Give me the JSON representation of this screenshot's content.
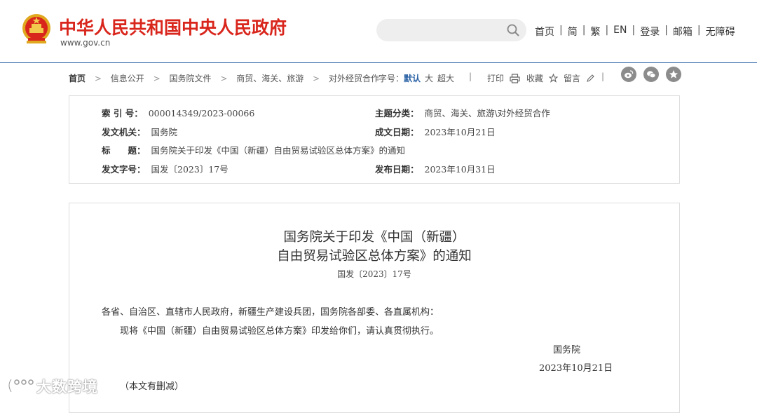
{
  "header": {
    "site_title": "中华人民共和国中央人民政府",
    "site_url": "www.gov.cn",
    "search": {
      "placeholder": ""
    },
    "links": [
      "首页",
      "简",
      "繁",
      "EN",
      "登录",
      "邮箱",
      "无障碍"
    ],
    "separator": "|"
  },
  "breadcrumb": {
    "items": [
      "首页",
      "信息公开",
      "国务院文件",
      "商贸、海关、旅游",
      "对外经贸合作"
    ],
    "arrow": ">",
    "font_size_label": "字号：",
    "font_size_options": [
      "默认",
      "大",
      "超大"
    ],
    "vbar": "|",
    "print_label": "打印",
    "favorite_label": "收藏",
    "comment_label": "留言"
  },
  "meta": {
    "index_no": {
      "label": "索 引 号：",
      "value": "000014349/2023-00066"
    },
    "category": {
      "label": "主题分类：",
      "value": "商贸、海关、旅游\\对外经贸合作"
    },
    "issuer": {
      "label": "发文机关：",
      "value": "国务院"
    },
    "written_date": {
      "label": "成文日期：",
      "value": "2023年10月21日"
    },
    "title": {
      "label": "标　　题：",
      "value": "国务院关于印发《中国（新疆）自由贸易试验区总体方案》的通知"
    },
    "doc_no": {
      "label": "发文字号：",
      "value": "国发〔2023〕17号"
    },
    "publish_date": {
      "label": "发布日期：",
      "value": "2023年10月31日"
    }
  },
  "document": {
    "title_line1": "国务院关于印发《中国（新疆）",
    "title_line2": "自由贸易试验区总体方案》的通知",
    "doc_number": "国发〔2023〕17号",
    "salutation": "各省、自治区、直辖市人民政府，新疆生产建设兵团，国务院各部委、各直属机构：",
    "body": "现将《中国（新疆）自由贸易试验区总体方案》印发给你们，请认真贯彻执行。",
    "signature": "国务院",
    "date": "2023年10月21日",
    "note": "（本文有删减）"
  },
  "watermark": {
    "text": "大数跨境"
  },
  "colors": {
    "title_red": "#d9261c",
    "link_blue": "#2c63a6",
    "border_gray": "#dddddd",
    "icon_gray": "#8c8c8c"
  }
}
